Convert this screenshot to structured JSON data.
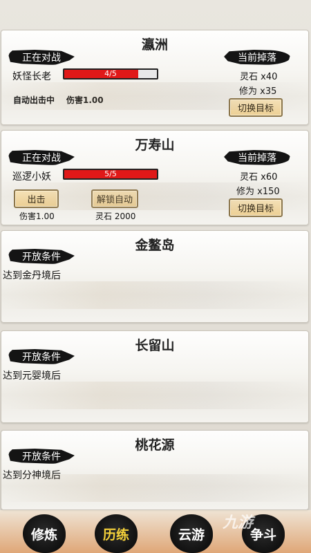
{
  "zones": [
    {
      "title": "瀛洲",
      "status_tag": "正在对战",
      "drop_tag": "当前掉落",
      "enemy": "妖怪长老",
      "hp_text": "4/5",
      "hp_fraction": 0.8,
      "auto_text": "自动出击中",
      "damage_text": "伤害1.00",
      "drops": [
        "灵石 x40",
        "修为 x35"
      ],
      "switch_label": "切换目标"
    },
    {
      "title": "万寿山",
      "status_tag": "正在对战",
      "drop_tag": "当前掉落",
      "enemy": "巡逻小妖",
      "hp_text": "5/5",
      "hp_fraction": 1.0,
      "attack_label": "出击",
      "damage_text": "伤害1.00",
      "unlock_auto_label": "解锁自动",
      "unlock_cost": "灵石 2000",
      "drops": [
        "灵石 x60",
        "修为 x150"
      ],
      "switch_label": "切换目标"
    },
    {
      "title": "金鳌岛",
      "cond_tag": "开放条件",
      "cond_text": "达到金丹境后"
    },
    {
      "title": "长留山",
      "cond_tag": "开放条件",
      "cond_text": "达到元婴境后"
    },
    {
      "title": "桃花源",
      "cond_tag": "开放条件",
      "cond_text": "达到分神境后"
    }
  ],
  "nav": {
    "items": [
      "修炼",
      "历练",
      "云游",
      "争斗"
    ],
    "active": "历练"
  },
  "watermark": "九游",
  "colors": {
    "hp": "#e01818",
    "active_nav": "#f6d23a",
    "tag_bg": "#141414"
  }
}
